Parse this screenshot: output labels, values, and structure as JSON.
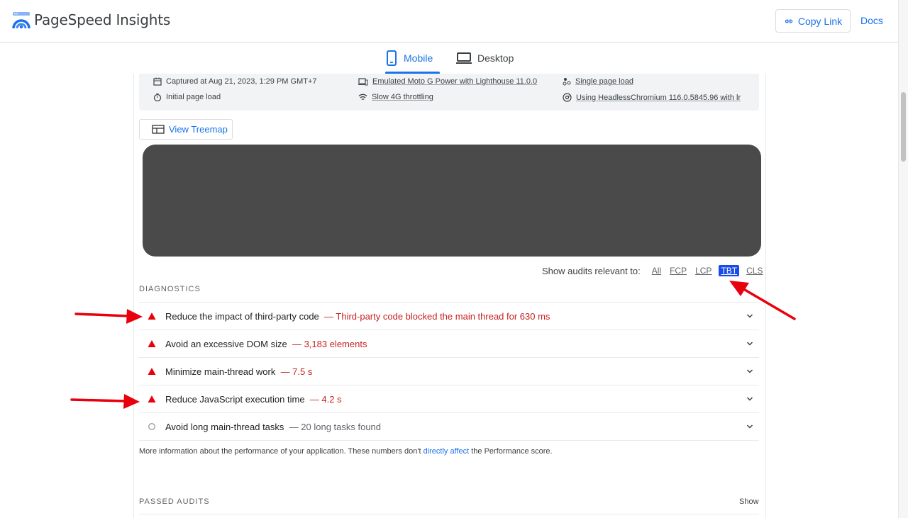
{
  "header": {
    "app_title": "PageSpeed Insights",
    "copy_link_label": "Copy Link",
    "docs_label": "Docs"
  },
  "tabs": [
    {
      "label": "Mobile",
      "active": true,
      "icon": "phone-icon"
    },
    {
      "label": "Desktop",
      "active": false,
      "icon": "laptop-icon"
    }
  ],
  "environment": {
    "captured": "Captured at Aug 21, 2023, 1:29 PM GMT+7",
    "initial_load": "Initial page load",
    "device": "Emulated Moto G Power with Lighthouse 11.0.0",
    "throttling": "Slow 4G throttling",
    "session": "Single page load",
    "browser": "Using HeadlessChromium 116.0.5845.96 with lr"
  },
  "treemap_label": "View Treemap",
  "filter": {
    "label": "Show audits relevant to:",
    "chips": [
      "All",
      "FCP",
      "LCP",
      "TBT",
      "CLS"
    ],
    "active": "TBT"
  },
  "diagnostics": {
    "title": "DIAGNOSTICS",
    "items": [
      {
        "title": "Reduce the impact of third-party code",
        "desc": "— Third-party code blocked the main thread for 630 ms",
        "status": "fail"
      },
      {
        "title": "Avoid an excessive DOM size",
        "desc": "— 3,183 elements",
        "status": "fail"
      },
      {
        "title": "Minimize main-thread work",
        "desc": "— 7.5 s",
        "status": "fail"
      },
      {
        "title": "Reduce JavaScript execution time",
        "desc": "— 4.2 s",
        "status": "fail"
      },
      {
        "title": "Avoid long main-thread tasks",
        "desc": "— 20 long tasks found",
        "status": "info"
      }
    ],
    "note_prefix": "More information about the performance of your application. These numbers don't",
    "note_link": "directly affect",
    "note_suffix": "the Performance score."
  },
  "passed_audits": {
    "title": "PASSED AUDITS",
    "show_label": "Show"
  },
  "colors": {
    "accent": "#1a73e8",
    "fail": "#e8000c",
    "fail_text": "#c5221f",
    "annotation_arrow": "#e8000c"
  }
}
